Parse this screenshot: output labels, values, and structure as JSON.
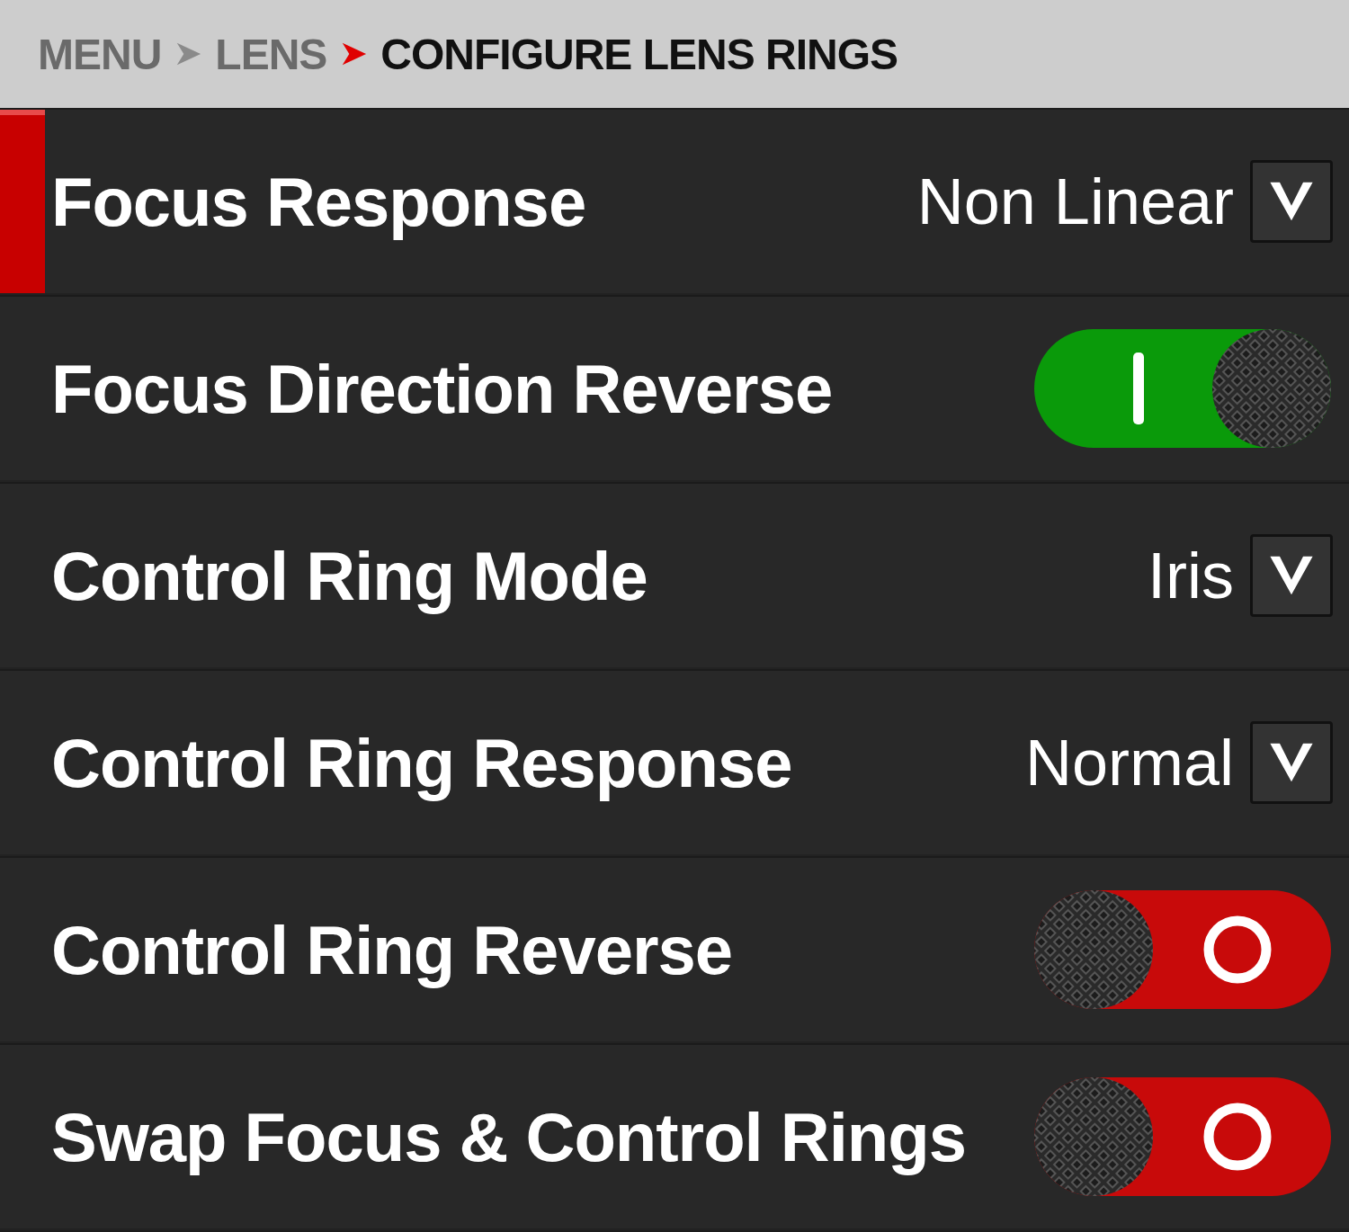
{
  "breadcrumb": [
    {
      "label": "MENU",
      "current": false
    },
    {
      "label": "LENS",
      "current": false
    },
    {
      "label": "CONFIGURE LENS RINGS",
      "current": true
    }
  ],
  "rows": [
    {
      "kind": "dropdown",
      "label": "Focus Response",
      "value": "Non Linear",
      "selected": true
    },
    {
      "kind": "toggle",
      "label": "Focus Direction Reverse",
      "on": true,
      "selected": false
    },
    {
      "kind": "dropdown",
      "label": "Control Ring Mode",
      "value": "Iris",
      "selected": false
    },
    {
      "kind": "dropdown",
      "label": "Control Ring Response",
      "value": "Normal",
      "selected": false
    },
    {
      "kind": "toggle",
      "label": "Control Ring Reverse",
      "on": false,
      "selected": false
    },
    {
      "kind": "toggle",
      "label": "Swap Focus & Control Rings",
      "on": false,
      "selected": false
    }
  ]
}
